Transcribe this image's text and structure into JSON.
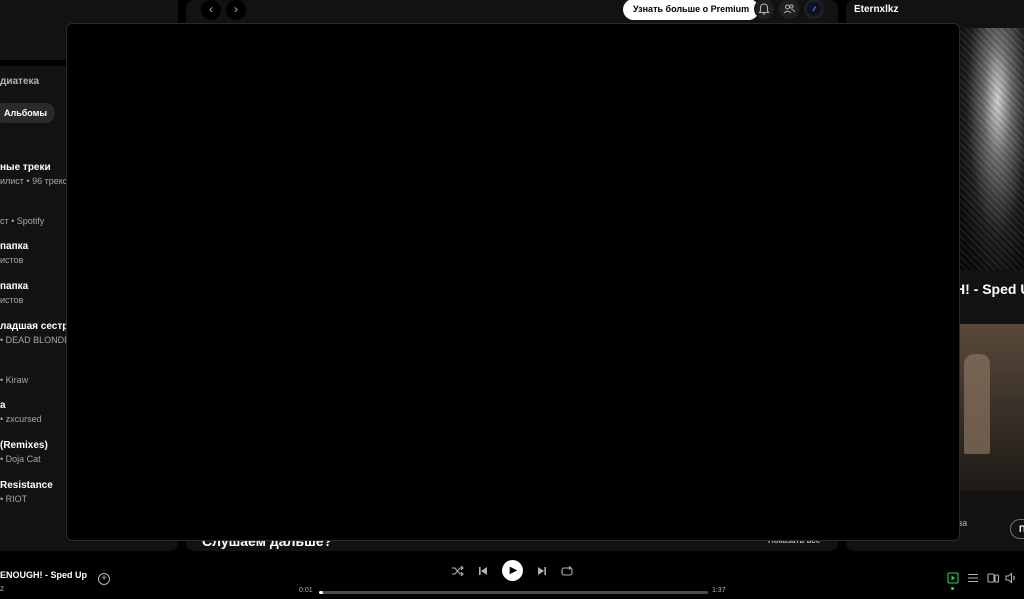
{
  "library": {
    "title": "диатека",
    "filter_chip": "Альбомы",
    "items": [
      {
        "title": "ные треки",
        "subtitle": "илист • 96 треков"
      },
      {
        "title": "",
        "subtitle": "ст • Spotify"
      },
      {
        "title": "папка",
        "subtitle": "истов"
      },
      {
        "title": "папка",
        "subtitle": "истов"
      },
      {
        "title": "ладшая сестра",
        "subtitle": "• DEAD BLONDE"
      },
      {
        "title": "",
        "subtitle": "• Kiraw"
      },
      {
        "title": "а",
        "subtitle": "• zxcursed"
      },
      {
        "title": "(Remixes)",
        "subtitle": "• Doja Cat"
      },
      {
        "title": "Resistance",
        "subtitle": "• RIOT"
      }
    ]
  },
  "topbar": {
    "back_icon": "chevron-left-icon",
    "forward_icon": "chevron-right-icon",
    "premium_label": "Узнать больше о Premium",
    "bell_icon": "bell-icon",
    "friends_icon": "friends-icon",
    "avatar_icon": "avatar-icon"
  },
  "main": {
    "section_title": "Слушаем дальше?",
    "show_all": "Показать все"
  },
  "right_panel": {
    "title": "Eternxlkz",
    "track_title": "H! - Sped U",
    "small_text": "за",
    "button_label": "П"
  },
  "player": {
    "track_title": "ENOUGH! - Sped Up",
    "track_sub": "z",
    "elapsed": "0:01",
    "duration": "1:37",
    "progress_fraction": 0.01,
    "colors": {
      "accent": "#1ed760"
    }
  }
}
